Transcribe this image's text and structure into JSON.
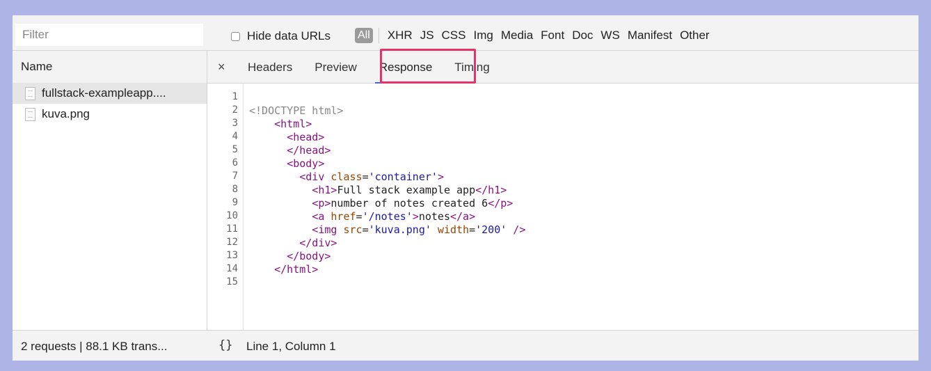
{
  "filter": {
    "placeholder": "Filter"
  },
  "hide_data_urls": {
    "label": "Hide data URLs",
    "checked": false
  },
  "resource_types": [
    "All",
    "XHR",
    "JS",
    "CSS",
    "Img",
    "Media",
    "Font",
    "Doc",
    "WS",
    "Manifest",
    "Other"
  ],
  "active_type": "All",
  "name_column": "Name",
  "close_glyph": "×",
  "tabs": [
    "Headers",
    "Preview",
    "Response",
    "Timing"
  ],
  "active_tab": "Response",
  "files": [
    {
      "name": "fullstack-exampleapp....",
      "icon": "document-icon",
      "selected": true
    },
    {
      "name": "kuva.png",
      "icon": "image-file-icon",
      "selected": false
    }
  ],
  "code": {
    "line_numbers": [
      "1",
      "2",
      "3",
      "4",
      "5",
      "6",
      "7",
      "8",
      "9",
      "10",
      "11",
      "12",
      "13",
      "14",
      "15"
    ],
    "lines": [
      [],
      [
        [
          "doctype",
          "<!DOCTYPE html>"
        ]
      ],
      [
        [
          "text",
          "    "
        ],
        [
          "tag",
          "<html>"
        ]
      ],
      [
        [
          "text",
          "      "
        ],
        [
          "tag",
          "<head>"
        ]
      ],
      [
        [
          "text",
          "      "
        ],
        [
          "tag",
          "</head>"
        ]
      ],
      [
        [
          "text",
          "      "
        ],
        [
          "tag",
          "<body>"
        ]
      ],
      [
        [
          "text",
          "        "
        ],
        [
          "tag",
          "<div "
        ],
        [
          "attr",
          "class"
        ],
        [
          "text",
          "="
        ],
        [
          "val",
          "'container'"
        ],
        [
          "tag",
          ">"
        ]
      ],
      [
        [
          "text",
          "          "
        ],
        [
          "tag",
          "<h1>"
        ],
        [
          "text",
          "Full stack example app"
        ],
        [
          "tag",
          "</h1>"
        ]
      ],
      [
        [
          "text",
          "          "
        ],
        [
          "tag",
          "<p>"
        ],
        [
          "text",
          "number of notes created 6"
        ],
        [
          "tag",
          "</p>"
        ]
      ],
      [
        [
          "text",
          "          "
        ],
        [
          "tag",
          "<a "
        ],
        [
          "attr",
          "href"
        ],
        [
          "text",
          "="
        ],
        [
          "val",
          "'/notes'"
        ],
        [
          "tag",
          ">"
        ],
        [
          "text",
          "notes"
        ],
        [
          "tag",
          "</a>"
        ]
      ],
      [
        [
          "text",
          "          "
        ],
        [
          "tag",
          "<img "
        ],
        [
          "attr",
          "src"
        ],
        [
          "text",
          "="
        ],
        [
          "val",
          "'kuva.png'"
        ],
        [
          "text",
          " "
        ],
        [
          "attr",
          "width"
        ],
        [
          "text",
          "="
        ],
        [
          "val",
          "'200'"
        ],
        [
          "tag",
          " />"
        ]
      ],
      [
        [
          "text",
          "        "
        ],
        [
          "tag",
          "</div>"
        ]
      ],
      [
        [
          "text",
          "      "
        ],
        [
          "tag",
          "</body>"
        ]
      ],
      [
        [
          "text",
          "    "
        ],
        [
          "tag",
          "</html>"
        ]
      ],
      []
    ]
  },
  "footer": {
    "status": "2 requests | 88.1 KB trans...",
    "format_glyph": "{}",
    "cursor_position": "Line 1, Column 1"
  },
  "colors": {
    "highlight": "#e3336b",
    "tab_underline": "#3c6ae0",
    "tag": "#881280",
    "attr": "#994500",
    "value": "#1a1aa6",
    "background": "#aeb4e6"
  }
}
